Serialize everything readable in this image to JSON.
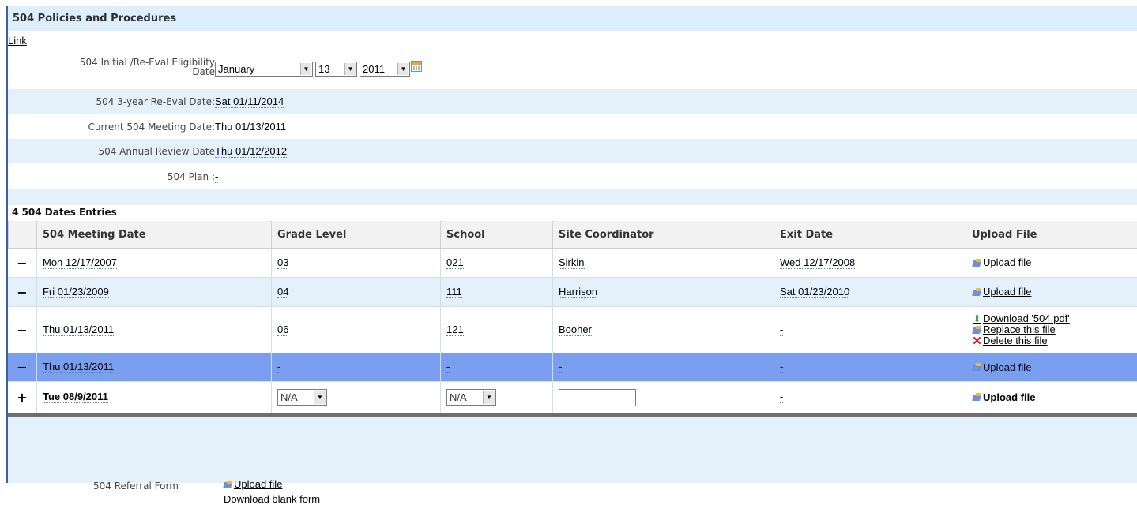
{
  "section": {
    "title": "504 Policies and Procedures",
    "link_label": "Link"
  },
  "eligibility": {
    "label_line1": "504 Initial /Re-Eval Eligibility",
    "label_line2": "Date",
    "month": "January",
    "day": "13",
    "year": "2011"
  },
  "fields": [
    {
      "label": "504 3-year Re-Eval Date:",
      "value": "Sat 01/11/2014"
    },
    {
      "label": "Current 504 Meeting Date:",
      "value": "Thu 01/13/2011"
    },
    {
      "label": "504 Annual Review Date",
      "value": "Thu 01/12/2012"
    },
    {
      "label": "504 Plan :",
      "value": "-"
    }
  ],
  "table": {
    "title": "4 504 Dates Entries",
    "headers": [
      "504 Meeting Date",
      "Grade Level",
      "School",
      "Site Coordinator",
      "Exit Date",
      "Upload File"
    ],
    "rows": [
      {
        "toggle": "−",
        "meeting_date": "Mon 12/17/2007",
        "grade": "03",
        "school": "021",
        "coordinator": "Sirkin",
        "exit_date": "Wed 12/17/2008",
        "upload": "Upload file"
      },
      {
        "toggle": "−",
        "meeting_date": "Fri 01/23/2009",
        "grade": "04",
        "school": "111",
        "coordinator": "Harrison",
        "exit_date": "Sat 01/23/2010",
        "upload": "Upload file"
      },
      {
        "toggle": "−",
        "meeting_date": "Thu 01/13/2011",
        "grade": "06",
        "school": "121",
        "coordinator": "Booher",
        "exit_date": "-",
        "download": "Download '504.pdf'",
        "replace": "Replace this file",
        "delete": "Delete this file"
      },
      {
        "toggle": "−",
        "meeting_date": "Thu 01/13/2011",
        "grade": "-",
        "school": "-",
        "coordinator": "-",
        "exit_date": "-",
        "upload": "Upload file"
      }
    ],
    "new_row": {
      "toggle": "+",
      "meeting_date": "Tue 08/9/2011",
      "grade_select": "N/A",
      "school_select": "N/A",
      "coordinator_input": "",
      "exit_date": "-",
      "upload": "Upload file"
    }
  },
  "referral": {
    "label": "504 Referral Form",
    "upload": "Upload file",
    "blank_form": "Download blank form"
  },
  "icons": {
    "calendar": "calendar-icon",
    "upload": "upload-icon",
    "download": "download-arrow-icon",
    "delete": "delete-x-icon",
    "dropdown": "chevron-down-icon"
  }
}
